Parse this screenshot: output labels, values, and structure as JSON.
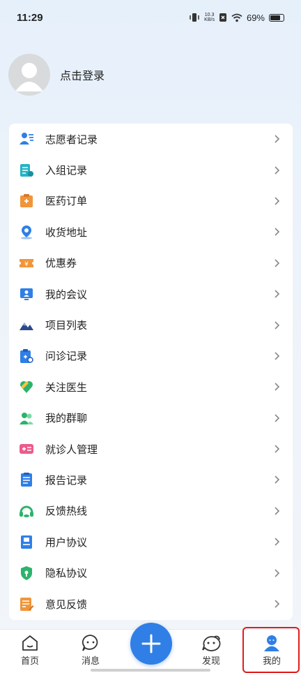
{
  "status_bar": {
    "time": "11:29",
    "net_speed_value": "10.3",
    "net_speed_unit": "KB/s",
    "battery": "69%"
  },
  "profile": {
    "login_text": "点击登录"
  },
  "menu": {
    "items": [
      {
        "label": "志愿者记录",
        "icon": "volunteer-icon",
        "color": "#2f7fe6"
      },
      {
        "label": "入组记录",
        "icon": "enrollment-icon",
        "color": "#25b3c4"
      },
      {
        "label": "医药订单",
        "icon": "medicine-order-icon",
        "color": "#f0963a"
      },
      {
        "label": "收货地址",
        "icon": "location-icon",
        "color": "#2f7fe6"
      },
      {
        "label": "优惠券",
        "icon": "coupon-icon",
        "color": "#f0963a"
      },
      {
        "label": "我的会议",
        "icon": "meeting-icon",
        "color": "#2f7fe6"
      },
      {
        "label": "项目列表",
        "icon": "project-icon",
        "color": "#2a4a8a"
      },
      {
        "label": "问诊记录",
        "icon": "consultation-icon",
        "color": "#2f7fe6"
      },
      {
        "label": "关注医生",
        "icon": "follow-doctor-icon",
        "color": "#2db36b"
      },
      {
        "label": "我的群聊",
        "icon": "group-chat-icon",
        "color": "#2db36b"
      },
      {
        "label": "就诊人管理",
        "icon": "patient-manage-icon",
        "color": "#ec5c8a"
      },
      {
        "label": "报告记录",
        "icon": "report-icon",
        "color": "#2f7fe6"
      },
      {
        "label": "反馈热线",
        "icon": "hotline-icon",
        "color": "#2db36b"
      },
      {
        "label": "用户协议",
        "icon": "user-agreement-icon",
        "color": "#2f7fe6"
      },
      {
        "label": "隐私协议",
        "icon": "privacy-icon",
        "color": "#2db36b"
      },
      {
        "label": "意见反馈",
        "icon": "feedback-icon",
        "color": "#f0963a"
      }
    ]
  },
  "tabbar": {
    "home": "首页",
    "messages": "消息",
    "discover": "发现",
    "mine": "我的"
  },
  "colors": {
    "accent": "#2f7fe6",
    "highlight": "#e01c1c"
  }
}
